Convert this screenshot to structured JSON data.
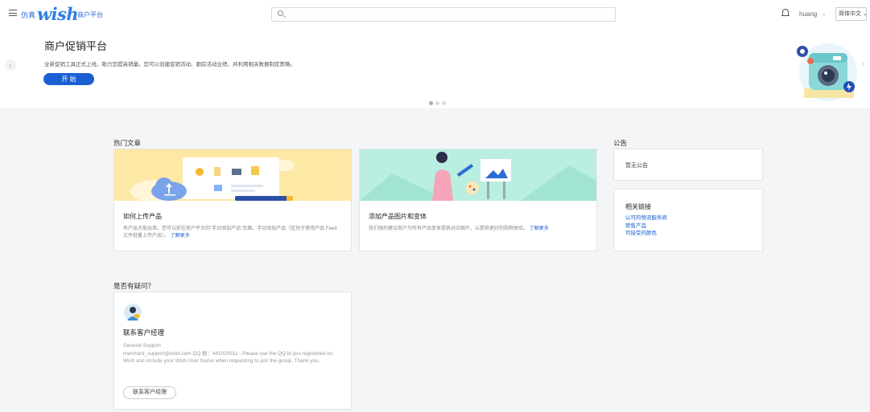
{
  "header": {
    "sim_label": "仿真",
    "logo_text": "wish",
    "platform_label": "商户平台",
    "search_placeholder": "",
    "user_name": "huang",
    "user_chevron": "⌄",
    "language": "简体中文 ⌄"
  },
  "banner": {
    "title": "商户促销平台",
    "description": "全新促销工具正式上线，助力您提高销量。您可以创建促销活动、跟踪活动业绩，并利用相关数据制定策略。",
    "start_label": "开 始",
    "slides_total": 3,
    "active_slide": 1
  },
  "popular": {
    "heading": "热门文章",
    "cards": [
      {
        "title": "如何上传产品",
        "desc": "有产品才能出单。您可以前往商户平台的\"手动添加产品\"页面、手动添加产品（区别于使用产品 Feed 文件批量上传产品）。",
        "link": "了解更多"
      },
      {
        "title": "添加产品图片和变体",
        "desc": "我们强烈建议商户为所有产品变体提供对应图片，以提供更好的购物体验。",
        "link": "了解更多"
      }
    ]
  },
  "notice": {
    "heading": "公告",
    "text": "暂无公告"
  },
  "related_links": {
    "title": "相关链接",
    "items": [
      "认可的物流服务商",
      "禁售产品",
      "可接受的颜色"
    ]
  },
  "faq": {
    "heading": "是否有疑问？",
    "title": "联系客户经理",
    "desc_line1": "General Support",
    "desc_line2": "merchant_support@wish.com QQ 群：441020511 - Please use the QQ id you registered on Wish and include your Wish User Name when requesting to join the group. Thank you.",
    "button_label": "联系客户经理"
  },
  "colors": {
    "accent": "#1a5fd1",
    "logo": "#2d7ee8",
    "card1_bg": "#fde8a6",
    "card2_bg": "#b9eee0"
  }
}
